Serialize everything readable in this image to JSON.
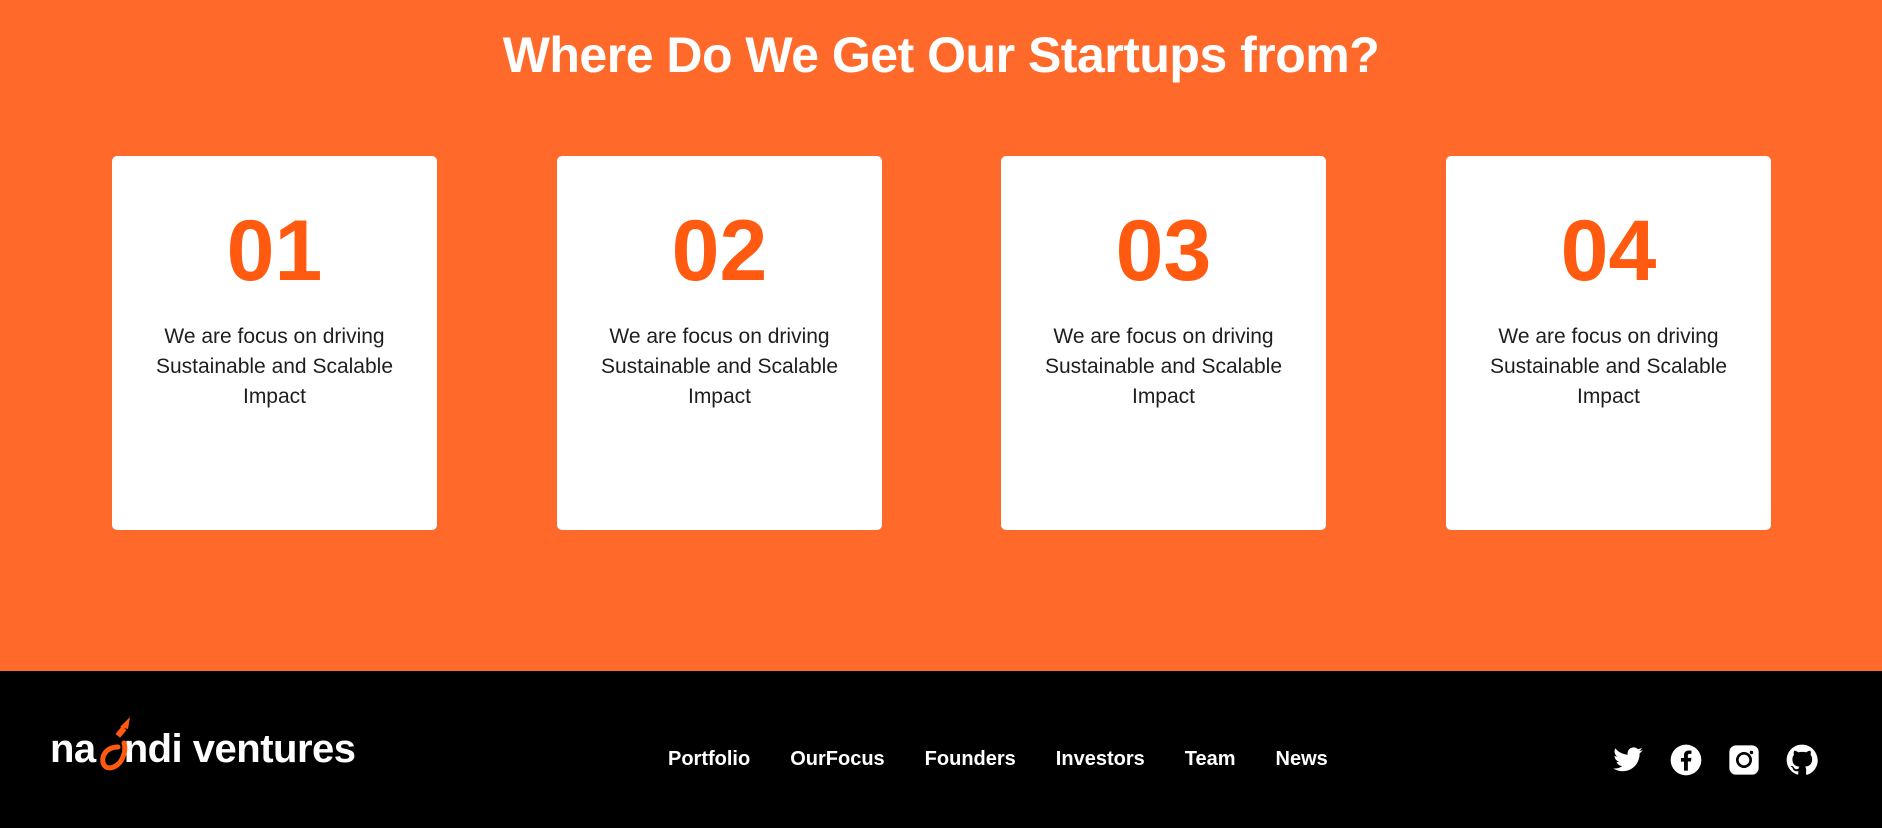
{
  "section": {
    "title": "Where Do We Get Our Startups from?"
  },
  "cards": [
    {
      "number": "01",
      "text": "We are focus on driving Sustainable and Scalable Impact"
    },
    {
      "number": "02",
      "text": "We are focus on driving Sustainable and Scalable Impact"
    },
    {
      "number": "03",
      "text": "We are focus on driving Sustainable and Scalable Impact"
    },
    {
      "number": "04",
      "text": "We are focus on driving Sustainable and Scalable Impact"
    }
  ],
  "footer": {
    "logo": {
      "part1": "na",
      "part2": "ndi ventures",
      "icon": "rocket-icon"
    },
    "nav": [
      "Portfolio",
      "OurFocus",
      "Founders",
      "Investors",
      "Team",
      "News"
    ],
    "social": [
      "twitter-icon",
      "facebook-icon",
      "instagram-icon",
      "github-icon"
    ]
  },
  "colors": {
    "hero_bg": "#ff6a2a",
    "accent": "#ff5a0f",
    "footer_bg": "#000000"
  }
}
